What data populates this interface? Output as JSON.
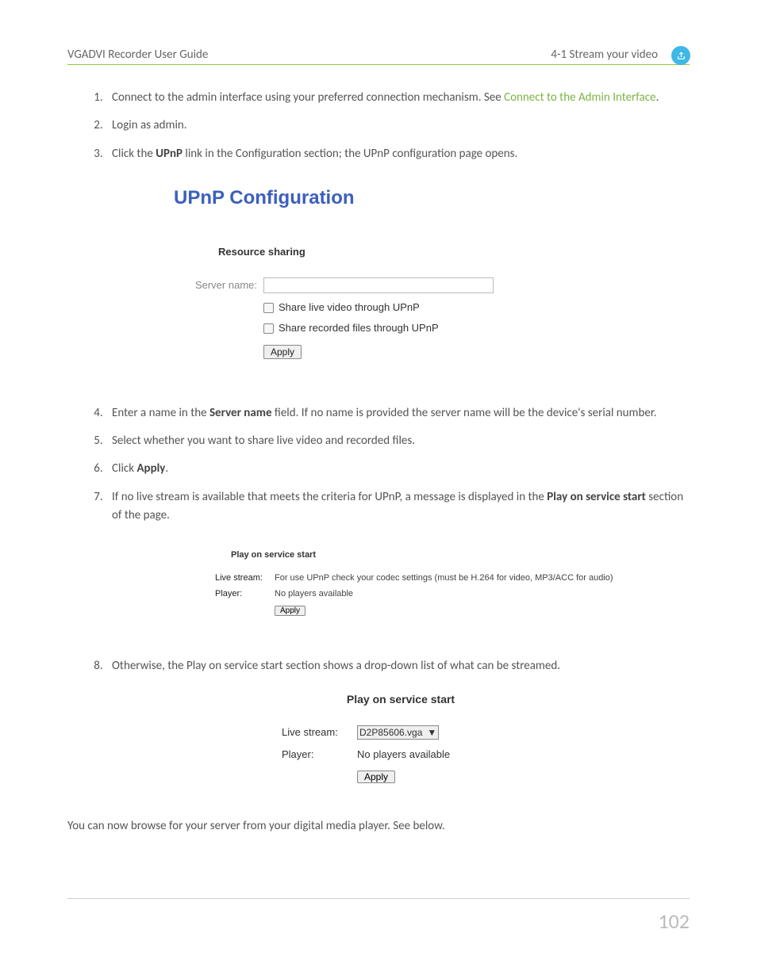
{
  "header": {
    "left": "VGADVI Recorder User Guide",
    "right": "4-1 Stream your video"
  },
  "steps": {
    "s1_a": "Connect to the admin interface using your preferred connection mechanism. See ",
    "s1_link": "Connect to the Admin Interface",
    "s1_b": ".",
    "s2": "Login as admin.",
    "s3_a": "Click the ",
    "s3_bold": "UPnP",
    "s3_b": " link in the Configuration section; the UPnP configuration page opens.",
    "s4_a": "Enter a name in the ",
    "s4_bold": "Server name",
    "s4_b": " field. If no name is provided the server name will be the device's serial number.",
    "s5": "Select whether you want to share live video and recorded files.",
    "s6_a": "Click ",
    "s6_bold": "Apply",
    "s6_b": ".",
    "s7_a": "If no live stream is available that meets the criteria for UPnP, a message is displayed in the ",
    "s7_bold": "Play on service start",
    "s7_b": " section of the page.",
    "s8": "Otherwise, the Play on service start section shows a drop-down list of what can be streamed."
  },
  "fig1": {
    "title": "UPnP Configuration",
    "section": "Resource sharing",
    "server_label": "Server name:",
    "server_value": "",
    "cb1": "Share live video through UPnP",
    "cb2": "Share recorded files through UPnP",
    "apply": "Apply"
  },
  "fig2": {
    "section": "Play on service start",
    "ls_label": "Live stream:",
    "ls_val": "For use UPnP check your codec settings (must be H.264 for video, MP3/ACC for audio)",
    "pl_label": "Player:",
    "pl_val": "No players available",
    "apply": "Apply"
  },
  "fig3": {
    "section": "Play on service start",
    "ls_label": "Live stream:",
    "ls_val": "D2P85606.vga",
    "pl_label": "Player:",
    "pl_val": "No players available",
    "apply": "Apply"
  },
  "closing": "You can now browse for your server from your digital media player. See below.",
  "page_number": "102"
}
